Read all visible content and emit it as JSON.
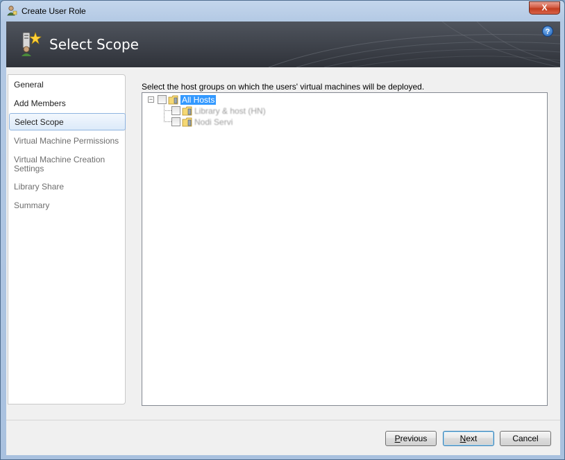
{
  "window": {
    "title": "Create User Role",
    "close_label": "X"
  },
  "header": {
    "title": "Select Scope",
    "help_label": "?"
  },
  "nav": {
    "items": [
      {
        "label": "General",
        "state": "normal"
      },
      {
        "label": "Add Members",
        "state": "normal"
      },
      {
        "label": "Select Scope",
        "state": "selected"
      },
      {
        "label": "Virtual Machine Permissions",
        "state": "disabled"
      },
      {
        "label": "Virtual Machine Creation Settings",
        "state": "disabled"
      },
      {
        "label": "Library Share",
        "state": "disabled"
      },
      {
        "label": "Summary",
        "state": "disabled"
      }
    ]
  },
  "instruction": "Select the host groups on which the users' virtual machines will be deployed.",
  "tree": {
    "root": {
      "label": "All Hosts",
      "expander": "−",
      "checked": false
    },
    "children": [
      {
        "label": "Library & host (HN)",
        "checked": false
      },
      {
        "label": "Nodi Servi",
        "checked": false
      }
    ]
  },
  "buttons": {
    "previous": {
      "label": "Previous",
      "mnemonic": "P",
      "rest": "revious"
    },
    "next": {
      "label": "Next",
      "mnemonic": "N",
      "rest": "ext"
    },
    "cancel": {
      "label": "Cancel"
    }
  },
  "colors": {
    "accent_selection": "#3399ff",
    "header_bg": "#3c4048",
    "close_red": "#c23d1f"
  }
}
